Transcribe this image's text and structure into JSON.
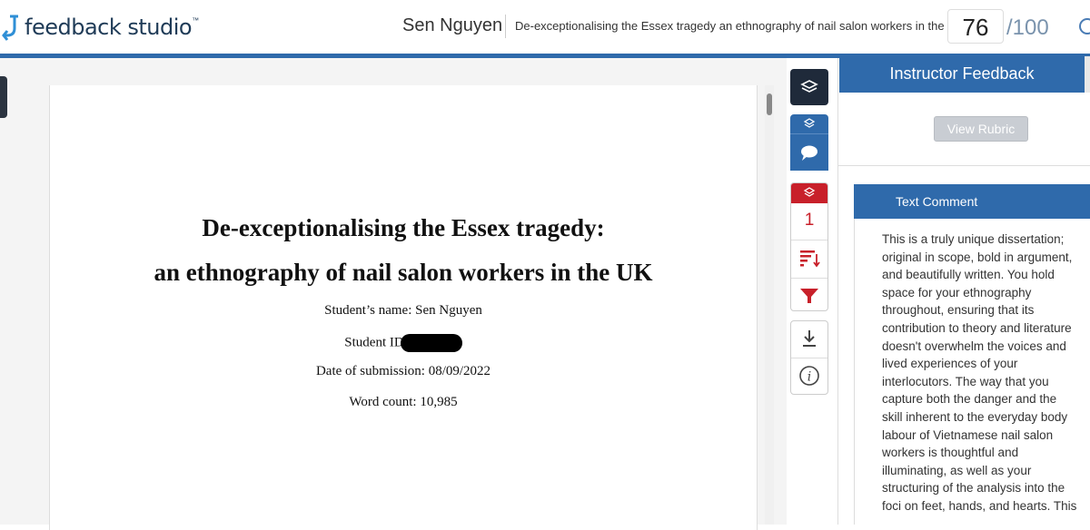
{
  "app": {
    "logo_text": "feedback studio",
    "logo_tm": "™"
  },
  "header": {
    "student_name": "Sen Nguyen",
    "paper_title": "De-exceptionalising the Essex tragedy an ethnography of nail salon workers in the UK",
    "score": "76",
    "score_total": "/100"
  },
  "document": {
    "title_line1": "De-exceptionalising the Essex tragedy:",
    "title_line2": "an ethnography of nail salon workers in the UK",
    "student_name_line": "Student’s name: Sen Nguyen",
    "student_id_label": "Student ID",
    "date_line": "Date of submission: 08/09/2022",
    "word_count_line": "Word count: 10,985"
  },
  "tools": {
    "flag_count": "1"
  },
  "panel": {
    "title": "Instructor Feedback",
    "view_rubric_label": "View Rubric",
    "comment_header": "Text Comment",
    "comment_text": "This is a truly unique dissertation; original in scope, bold in argument, and beautifully written. You hold space for your ethnography throughout, ensuring that its contribution to theory and literature doesn't overwhelm the voices and lived experiences of your interlocutors. The way that you capture both the danger and the skill inherent to the everyday body labour of Vietnamese nail salon workers is thoughtful and illuminating, as well as your structuring of the analysis into the foci on feet, hands, and hearts. This dissertation provides"
  },
  "colors": {
    "brand_blue": "#2f6aab",
    "flag_red": "#c8202a",
    "dark_button": "#1f2a3a"
  },
  "icons": {
    "layers": "layers-icon",
    "comment": "comment-bubble-icon",
    "sort": "sort-icon",
    "filter": "filter-icon",
    "download": "download-icon",
    "info": "info-icon",
    "clock": "clock-icon"
  }
}
